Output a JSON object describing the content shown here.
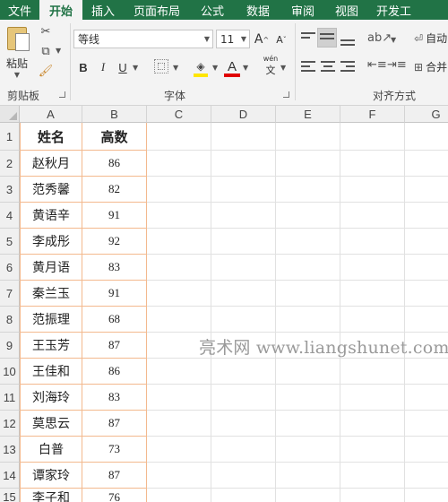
{
  "tabs": [
    {
      "label": "文件",
      "active": false
    },
    {
      "label": "开始",
      "active": true
    },
    {
      "label": "插入",
      "active": false
    },
    {
      "label": "页面布局",
      "active": false
    },
    {
      "label": "公式",
      "active": false
    },
    {
      "label": "数据",
      "active": false
    },
    {
      "label": "审阅",
      "active": false
    },
    {
      "label": "视图",
      "active": false
    },
    {
      "label": "开发工",
      "active": false
    }
  ],
  "ribbon": {
    "clipboard": {
      "label": "剪贴板",
      "paste_label": "粘贴"
    },
    "font": {
      "label": "字体",
      "font_name": "等线",
      "font_size": "11",
      "bold": "B",
      "italic": "I",
      "underline": "U",
      "font_color_glyph": "A",
      "phonetic_glyph": "wén",
      "grow_glyph": "A",
      "shrink_glyph": "A"
    },
    "alignment": {
      "label": "对齐方式",
      "wrap_label": "自动",
      "merge_label": "合并"
    },
    "colors": {
      "accent": "#217346",
      "highlight": "#ffe600",
      "font_color": "#e00000"
    }
  },
  "columns": [
    "A",
    "B",
    "C",
    "D",
    "E",
    "F",
    "G"
  ],
  "rows": [
    "1",
    "2",
    "3",
    "4",
    "5",
    "6",
    "7",
    "8",
    "9",
    "10",
    "11",
    "12",
    "13",
    "14",
    "15"
  ],
  "table": {
    "headers": [
      "姓名",
      "高数"
    ],
    "records": [
      {
        "name": "赵秋月",
        "score": "86"
      },
      {
        "name": "范秀馨",
        "score": "82"
      },
      {
        "name": "黄语辛",
        "score": "91"
      },
      {
        "name": "李成彤",
        "score": "92"
      },
      {
        "name": "黄月语",
        "score": "83"
      },
      {
        "name": "秦兰玉",
        "score": "91"
      },
      {
        "name": "范振理",
        "score": "68"
      },
      {
        "name": "王玉芳",
        "score": "87"
      },
      {
        "name": "王佳和",
        "score": "86"
      },
      {
        "name": "刘海玲",
        "score": "83"
      },
      {
        "name": "莫思云",
        "score": "87"
      },
      {
        "name": "白普",
        "score": "73"
      },
      {
        "name": "谭家玲",
        "score": "87"
      },
      {
        "name": "李子和",
        "score": "76"
      }
    ]
  },
  "watermark": "亮术网 www.liangshunet.com"
}
